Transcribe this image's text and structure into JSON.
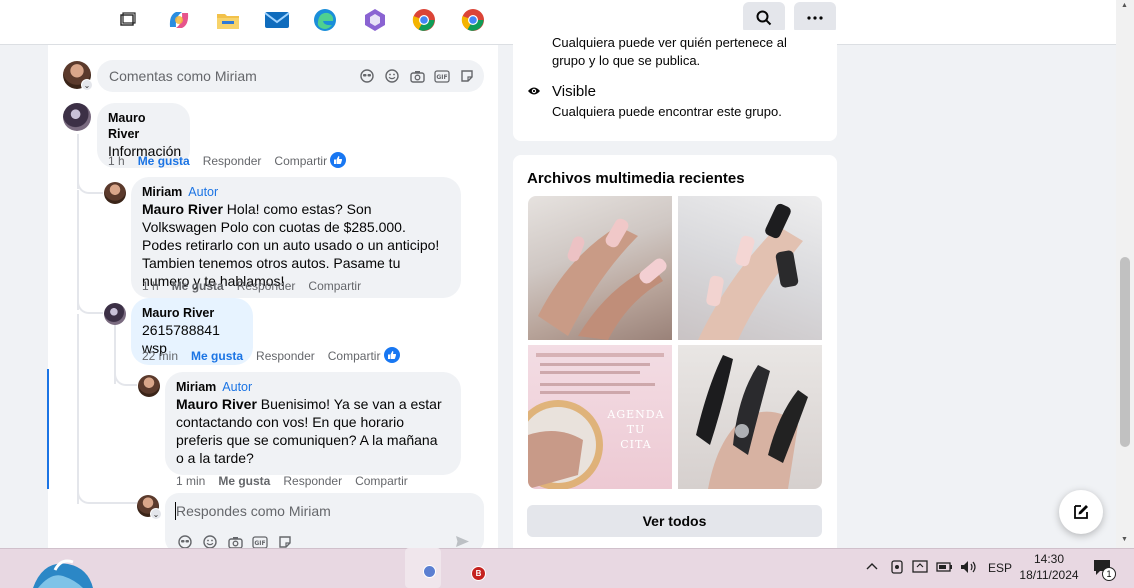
{
  "topbar": {
    "search_icon": "search-icon",
    "more_icon": "more-horizontal-icon"
  },
  "composer_top": {
    "placeholder": "Comentas como Miriam"
  },
  "comments": [
    {
      "author": "Mauro River",
      "text": "Información",
      "time": "1 h",
      "like_label": "Me gusta",
      "reply_label": "Responder",
      "share_label": "Compartir"
    },
    {
      "author": "Miriam",
      "badge": "Autor",
      "mention": "Mauro River",
      "text": " Hola! como estas? Son Volkswagen Polo con cuotas de $285.000. Podes retirarlo con un auto usado o un anticipo! Tambien tenemos otros autos. Pasame tu numero y te hablamos!",
      "time": "1 h",
      "like_label": "Me gusta",
      "reply_label": "Responder",
      "share_label": "Compartir"
    },
    {
      "author": "Mauro River",
      "text": "2615788841 wsp",
      "time": "22 min",
      "like_label": "Me gusta",
      "reply_label": "Responder",
      "share_label": "Compartir"
    },
    {
      "author": "Miriam",
      "badge": "Autor",
      "mention": "Mauro River",
      "text": " Buenisimo! Ya se van a estar contactando con vos! En que horario preferis que se comuniquen? A la mañana o a la tarde?",
      "time": "1 min",
      "like_label": "Me gusta",
      "reply_label": "Responder",
      "share_label": "Compartir"
    }
  ],
  "composer_reply": {
    "placeholder": "Respondes como Miriam"
  },
  "about": {
    "private_sub_partial": "Cualquiera puede ver quién pertenece al grupo y lo que se publica.",
    "visible_title": "Visible",
    "visible_sub": "Cualquiera puede encontrar este grupo."
  },
  "media": {
    "title": "Archivos multimedia recientes",
    "thumb3_text": [
      "AGENDA",
      "TU",
      "CITA"
    ],
    "see_all": "Ver todos"
  },
  "taskbar": {
    "language": "ESP",
    "time": "14:30",
    "date": "18/11/2024",
    "notification_count": "1",
    "chrome_profile_letter": "B"
  },
  "colors": {
    "accent": "#1b74e4",
    "like_blue": "#1877f2",
    "taskbar": "#e8d8e2"
  }
}
